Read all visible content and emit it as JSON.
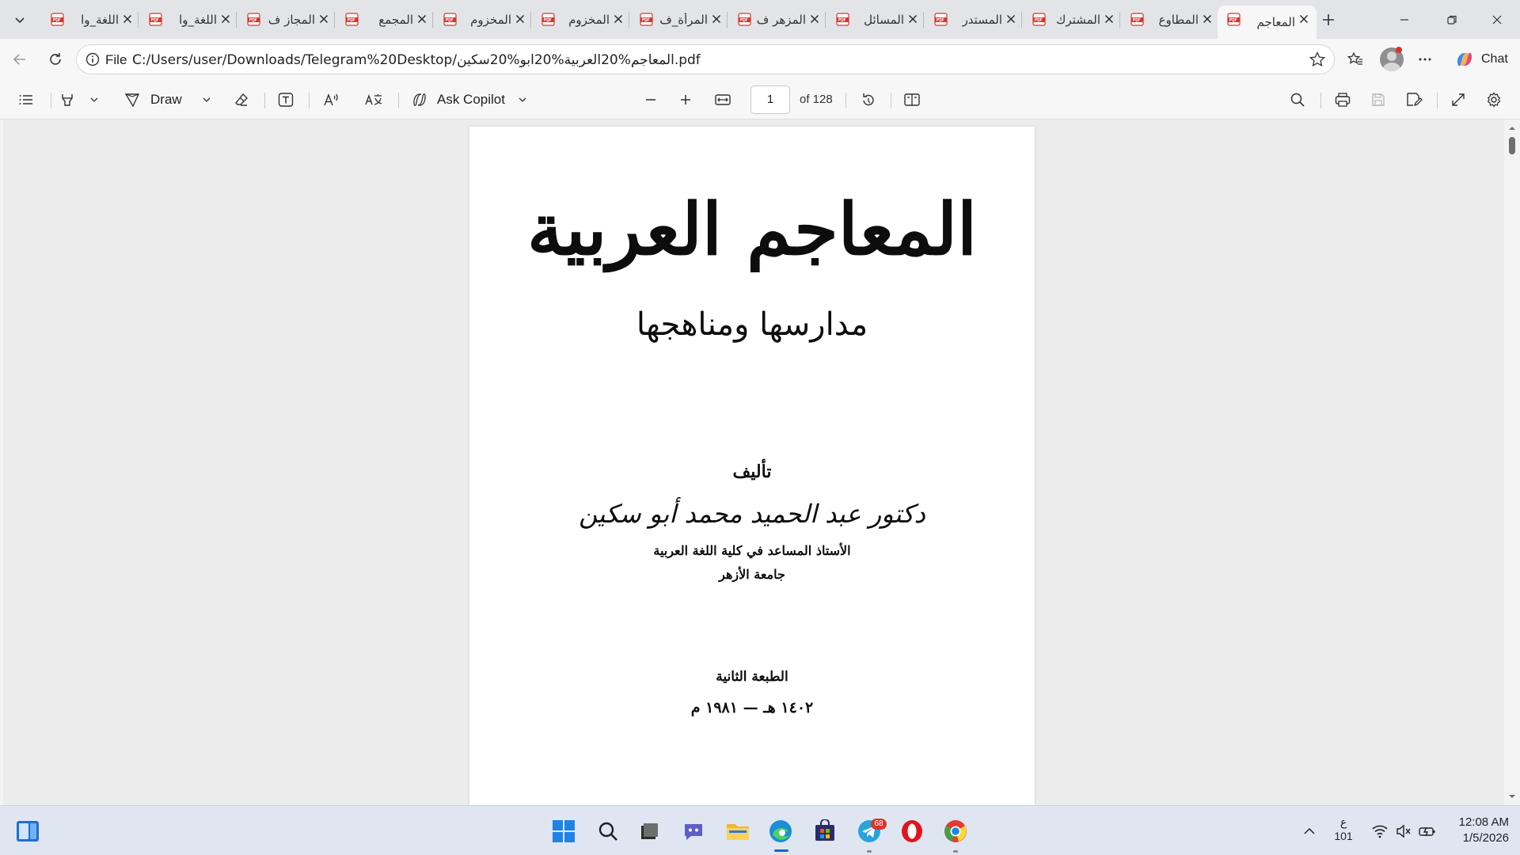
{
  "tabs": [
    {
      "title": "اللغة_وا",
      "active": false
    },
    {
      "title": "اللغة_وا",
      "active": false
    },
    {
      "title": "المجاز ف",
      "active": false
    },
    {
      "title": "المجمع",
      "active": false
    },
    {
      "title": "المخزوم",
      "active": false
    },
    {
      "title": "المخزوم",
      "active": false
    },
    {
      "title": "المرأة_ف",
      "active": false
    },
    {
      "title": "المزهر ف",
      "active": false
    },
    {
      "title": "المسائل",
      "active": false
    },
    {
      "title": "المستدر",
      "active": false
    },
    {
      "title": "المشترك",
      "active": false
    },
    {
      "title": "المطاوع",
      "active": false
    },
    {
      "title": "المعاجم",
      "active": true
    }
  ],
  "address": {
    "scheme": "File",
    "url": "C:/Users/user/Downloads/Telegram%20Desktop/المعاجم%20العربية%20ابو%20سكين.pdf"
  },
  "chat_label": "Chat",
  "pdf_toolbar": {
    "draw_label": "Draw",
    "copilot_label": "Ask Copilot",
    "page_current": "1",
    "page_total": "of 128"
  },
  "document": {
    "title": "المعاجم العربية",
    "subtitle": "مدارسها ومناهجها",
    "authored_by": "تأليف",
    "author": "دكتور عبد الحميد محمد أبو سكين",
    "position": "الأستاذ المساعد في كلية اللغة العربية",
    "university": "جامعة الأزهر",
    "edition": "الطبعة الثانية",
    "date": "١٤٠٢ هـ — ١٩٨١ م"
  },
  "taskbar": {
    "telegram_badge": "68",
    "lang_top": "ع",
    "lang_bottom": "101",
    "time": "12:08 AM",
    "date": "1/5/2026"
  },
  "colors": {
    "tab_strip": "#e3e4e8",
    "toolbar": "#f7f7f7",
    "viewer_bg": "#ececec",
    "pdf_badge_red": "#d7362b",
    "taskbar": "#dfe6f2"
  }
}
